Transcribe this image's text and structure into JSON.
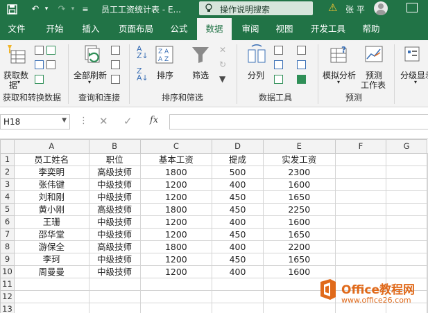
{
  "title_bar": {
    "title": "员工工资统计表 - E...",
    "search_placeholder": "操作说明搜索",
    "user_name": "张 平"
  },
  "tabs": [
    "文件",
    "开始",
    "插入",
    "页面布局",
    "公式",
    "数据",
    "审阅",
    "视图",
    "开发工具",
    "帮助"
  ],
  "active_tab": "数据",
  "ribbon": {
    "get_data_line1": "获取数",
    "get_data_line2": "据",
    "refresh_all": "全部刷新",
    "sort": "排序",
    "filter": "筛选",
    "split": "分列",
    "what_if": "模拟分析",
    "forecast_line1": "预测",
    "forecast_line2": "工作表",
    "outline": "分级显示",
    "groups": {
      "get_transform": "获取和转换数据",
      "queries": "查询和连接",
      "sort_filter": "排序和筛选",
      "data_tools": "数据工具",
      "forecast": "预测"
    }
  },
  "formula_bar": {
    "name_box": "H18",
    "fx": "fx",
    "formula": ""
  },
  "sheet": {
    "columns": [
      "A",
      "B",
      "C",
      "D",
      "E",
      "F",
      "G"
    ],
    "row_numbers": [
      "1",
      "2",
      "3",
      "4",
      "5",
      "6",
      "7",
      "8",
      "9",
      "10",
      "11",
      "12",
      "13"
    ],
    "rows": [
      [
        "员工姓名",
        "职位",
        "基本工资",
        "提成",
        "实发工资",
        "",
        ""
      ],
      [
        "李奕明",
        "高级技师",
        "1800",
        "500",
        "2300",
        "",
        ""
      ],
      [
        "张伟键",
        "中级技师",
        "1200",
        "400",
        "1600",
        "",
        ""
      ],
      [
        "刘和刚",
        "中级技师",
        "1200",
        "450",
        "1650",
        "",
        ""
      ],
      [
        "黄小刚",
        "高级技师",
        "1800",
        "450",
        "2250",
        "",
        ""
      ],
      [
        "王珊",
        "中级技师",
        "1200",
        "400",
        "1600",
        "",
        ""
      ],
      [
        "邵华堂",
        "中级技师",
        "1200",
        "450",
        "1650",
        "",
        ""
      ],
      [
        "游保全",
        "高级技师",
        "1800",
        "400",
        "2200",
        "",
        ""
      ],
      [
        "李珂",
        "中级技师",
        "1200",
        "450",
        "1650",
        "",
        ""
      ],
      [
        "周曼曼",
        "中级技师",
        "1200",
        "400",
        "1600",
        "",
        ""
      ],
      [
        "",
        "",
        "",
        "",
        "",
        "",
        ""
      ],
      [
        "",
        "",
        "",
        "",
        "",
        "",
        ""
      ],
      [
        "",
        "",
        "",
        "",
        "",
        "",
        ""
      ]
    ]
  },
  "watermark": {
    "name": "Office教程网",
    "url": "www.office26.com"
  },
  "colors": {
    "brand_green": "#217346",
    "watermark_orange": "#e06a1b"
  }
}
